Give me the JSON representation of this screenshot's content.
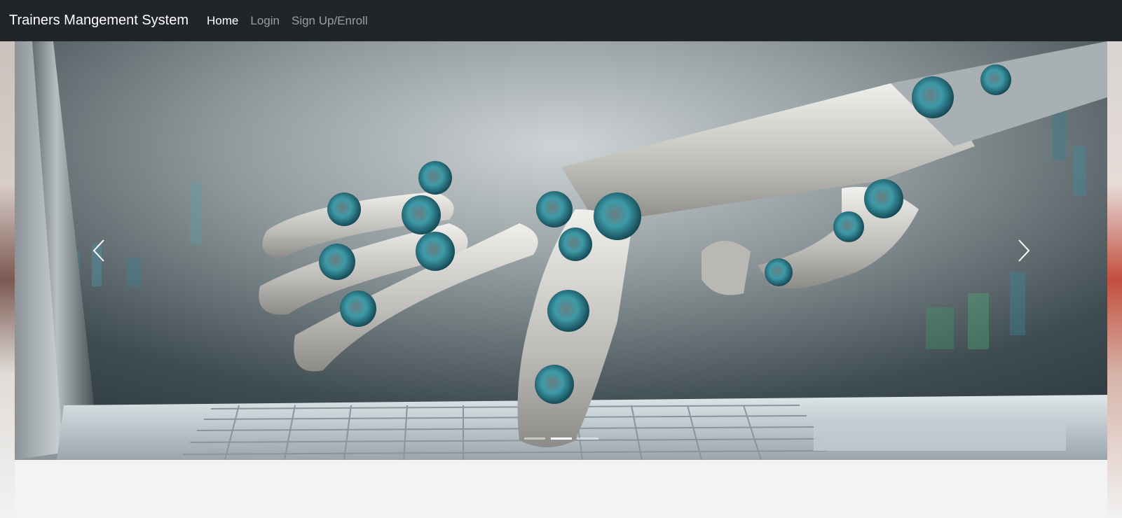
{
  "navbar": {
    "brand": "Trainers Mangement System",
    "links": [
      {
        "label": "Home",
        "active": true
      },
      {
        "label": "Login",
        "active": false
      },
      {
        "label": "Sign Up/Enroll",
        "active": false
      }
    ],
    "background_color": "#212529"
  },
  "carousel": {
    "slide_image": "robotic hand pressing a laptop keyboard",
    "controls": {
      "prev_icon": "chevron-left-icon",
      "next_icon": "chevron-right-icon"
    },
    "indicators": {
      "count": 3,
      "active_index": 1
    }
  },
  "colors": {
    "navbar_bg": "#212529",
    "nav_active": "#ffffff",
    "nav_inactive": "#9a9da0",
    "content_bg": "#f3f3f3"
  }
}
